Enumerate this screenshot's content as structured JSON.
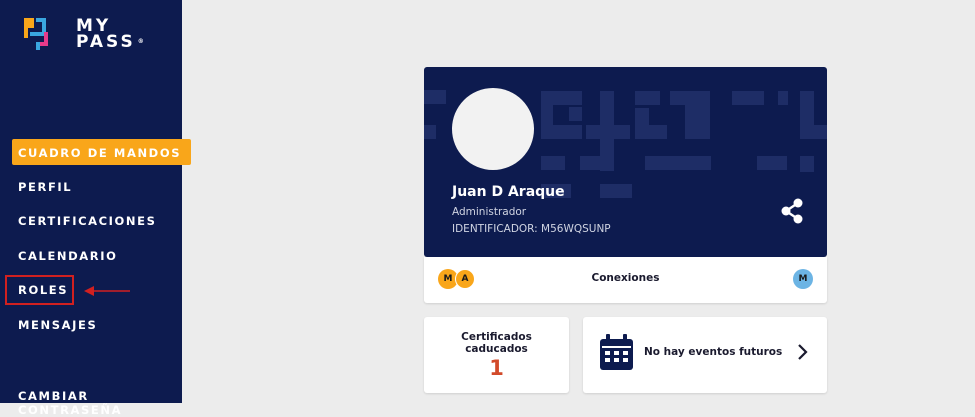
{
  "brand": {
    "line1": "MY",
    "line2": "PASS",
    "mark": "®"
  },
  "sidebar": {
    "items": [
      {
        "label": "CUADRO DE MANDOS",
        "active": true
      },
      {
        "label": "PERFIL"
      },
      {
        "label": "CERTIFICACIONES"
      },
      {
        "label": "CALENDARIO"
      },
      {
        "label": "ROLES",
        "highlighted": true
      },
      {
        "label": "MENSAJES"
      },
      {
        "label": "CAMBIAR CONTRASEÑA"
      }
    ]
  },
  "profile": {
    "name": "Juan D Araque",
    "role": "Administrador",
    "identifier": "IDENTIFICADOR: M56WQSUNP",
    "share_icon": "share-icon"
  },
  "connections": {
    "label": "Conexiones",
    "left_badges": [
      "M",
      "A"
    ],
    "right_badges": [
      "M"
    ]
  },
  "certificates": {
    "title": "Certificados\ncaducados",
    "count": "1"
  },
  "events": {
    "label": "No hay eventos futuros",
    "icon": "calendar-icon"
  },
  "colors": {
    "sidebar_bg": "#0d1b4f",
    "accent": "#f9a61a",
    "highlight": "#d12020",
    "badge_orange": "#f9a61a",
    "badge_blue": "#6cb4e4",
    "count_red": "#d24a2a"
  }
}
